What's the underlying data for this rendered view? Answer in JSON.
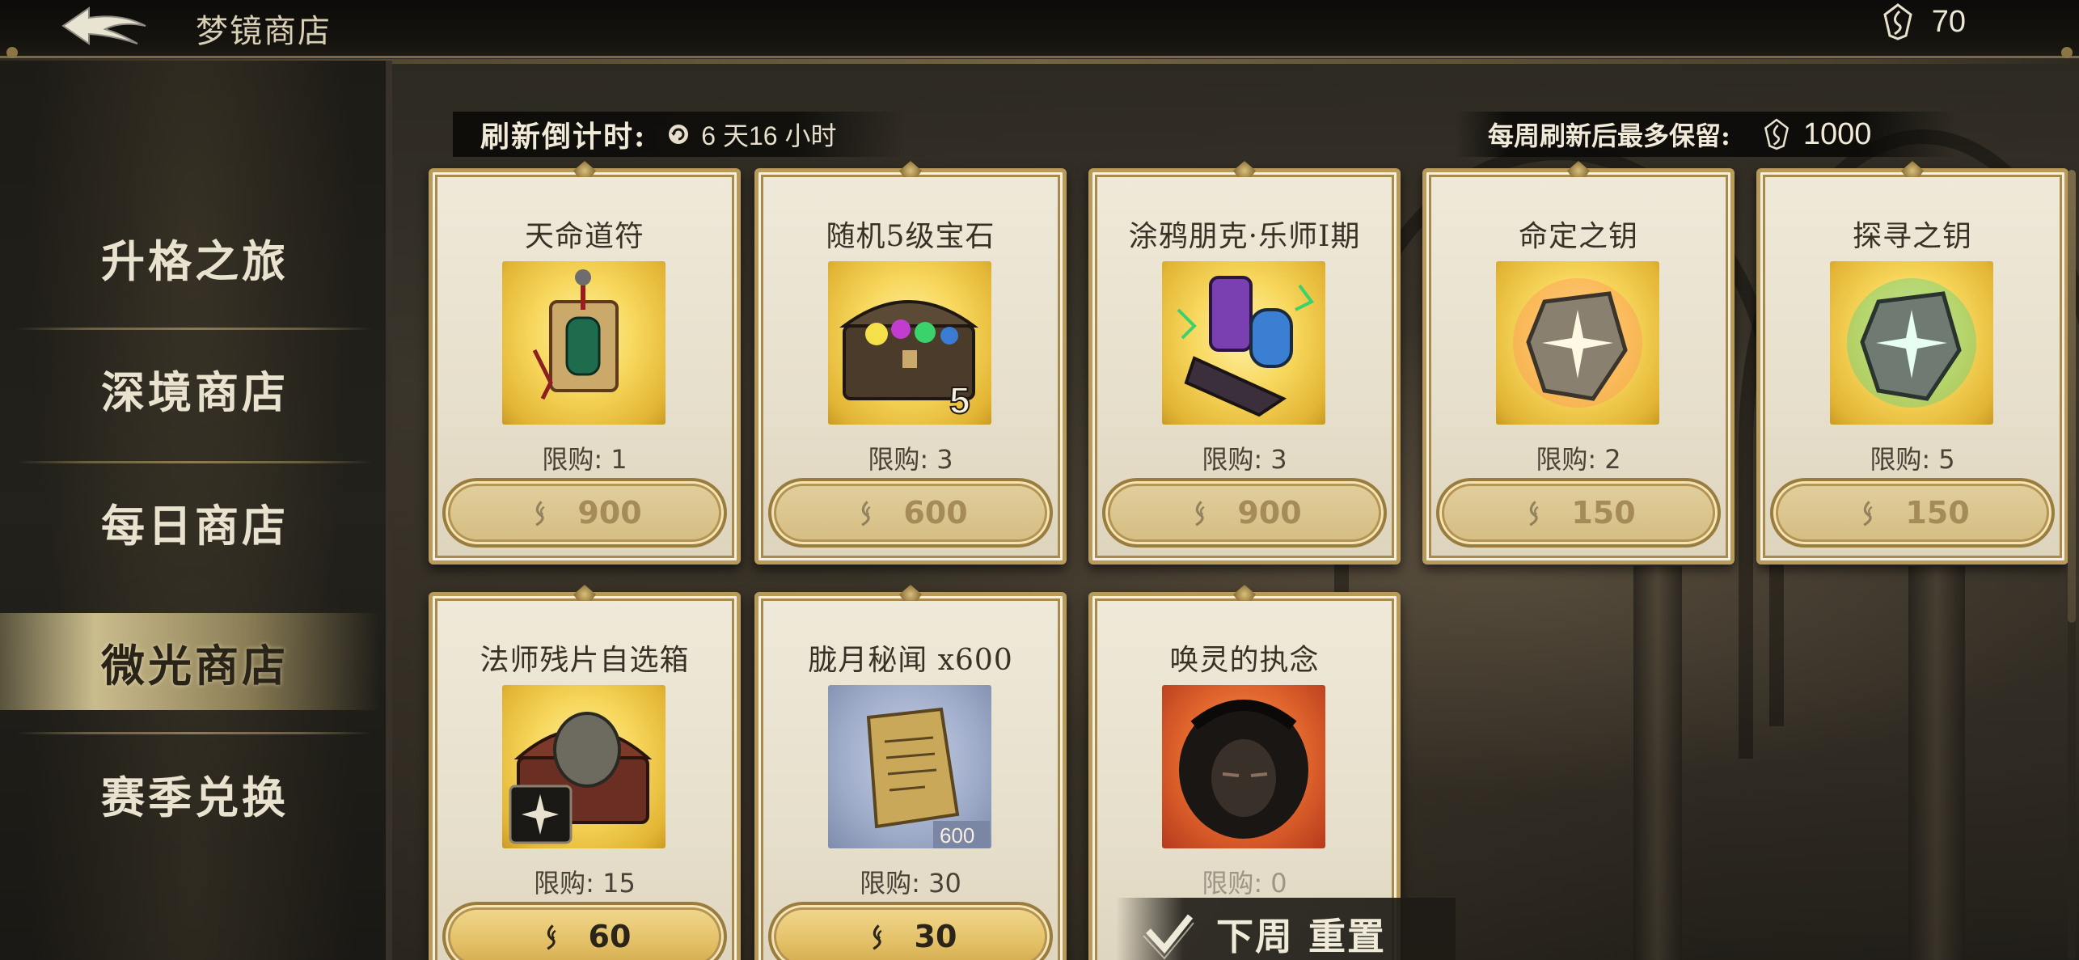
{
  "header": {
    "title": "梦镜商店",
    "currency_amount": "70"
  },
  "sidebar": {
    "items": [
      {
        "label": "升格之旅",
        "active": false
      },
      {
        "label": "深境商店",
        "active": false
      },
      {
        "label": "每日商店",
        "active": false
      },
      {
        "label": "微光商店",
        "active": true
      },
      {
        "label": "赛季兑换",
        "active": false
      }
    ]
  },
  "info": {
    "refresh_label": "刷新倒计时:",
    "refresh_time": "6 天16 小时",
    "keep_label": "每周刷新后最多保留:",
    "keep_value": "1000"
  },
  "items": [
    {
      "name": "天命道符",
      "limit": "限购: 1",
      "price": "900",
      "affordable": false,
      "image": "talisman-icon",
      "bg": "gold"
    },
    {
      "name": "随机5级宝石",
      "limit": "限购: 3",
      "price": "600",
      "affordable": false,
      "image": "gem-chest-icon",
      "bg": "gold",
      "badge": "5"
    },
    {
      "name": "涂鸦朋克·乐师I期",
      "limit": "限购: 3",
      "price": "900",
      "affordable": false,
      "image": "graffiti-gauntlet-icon",
      "bg": "gold"
    },
    {
      "name": "命定之钥",
      "limit": "限购: 2",
      "price": "150",
      "affordable": false,
      "image": "fate-key-stone-icon",
      "bg": "gold"
    },
    {
      "name": "探寻之钥",
      "limit": "限购: 5",
      "price": "150",
      "affordable": false,
      "image": "seek-key-stone-icon",
      "bg": "gold"
    },
    {
      "name": "法师残片自选箱",
      "limit": "限购: 15",
      "price": "60",
      "affordable": true,
      "image": "mage-shard-chest-icon",
      "bg": "gold"
    },
    {
      "name": "胧月秘闻 x600",
      "limit": "限购: 30",
      "price": "30",
      "affordable": true,
      "image": "scroll-parchment-icon",
      "bg": "blue",
      "badge": "600"
    },
    {
      "name": "唤灵的执念",
      "limit": "限购: 0",
      "price": "",
      "affordable": false,
      "image": "spirit-portrait-icon",
      "bg": "red",
      "soldout": true
    }
  ],
  "reset_banner": {
    "text": "下周 重置"
  },
  "colors": {
    "accent_gold": "#e3c067",
    "card_bg": "#efe9d9",
    "card_border": "#b89a5a"
  }
}
